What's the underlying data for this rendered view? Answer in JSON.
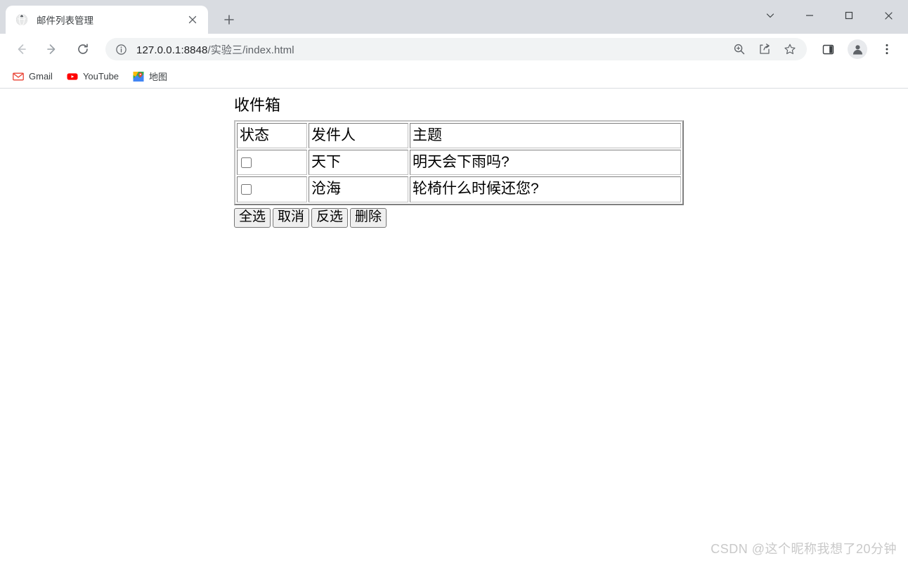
{
  "browser": {
    "tab": {
      "title": "邮件列表管理",
      "favicon": "globe-icon",
      "close_label": "×"
    },
    "new_tab_label": "+",
    "window_controls": {
      "tab_search": "tab-search-icon",
      "minimize": "minimize-icon",
      "maximize": "maximize-icon",
      "close": "close-icon"
    },
    "toolbar": {
      "back": "back-arrow-icon",
      "forward": "forward-arrow-icon",
      "reload": "reload-icon",
      "site_info": "info-circle-icon",
      "url_host": "127.0.0.1:8848",
      "url_path": "/实验三/index.html",
      "url_full": "127.0.0.1:8848/实验三/index.html",
      "zoom": "zoom-in-icon",
      "share": "share-icon",
      "bookmark": "star-icon",
      "side_panel": "side-panel-icon",
      "profile": "profile-avatar-icon",
      "menu": "three-dot-menu-icon"
    },
    "bookmarks": [
      {
        "label": "Gmail",
        "icon": "gmail-icon"
      },
      {
        "label": "YouTube",
        "icon": "youtube-icon"
      },
      {
        "label": "地图",
        "icon": "google-maps-icon"
      }
    ]
  },
  "page": {
    "heading": "收件箱",
    "table": {
      "headers": [
        "状态",
        "发件人",
        "主题"
      ],
      "rows": [
        {
          "checked": false,
          "sender": "天下",
          "subject": "明天会下雨吗?"
        },
        {
          "checked": false,
          "sender": "沧海",
          "subject": "轮椅什么时候还您?"
        }
      ]
    },
    "buttons": [
      {
        "label": "全选",
        "name": "select-all-button"
      },
      {
        "label": "取消",
        "name": "deselect-all-button"
      },
      {
        "label": "反选",
        "name": "invert-selection-button"
      },
      {
        "label": "删除",
        "name": "delete-button"
      }
    ]
  },
  "watermark": "CSDN @这个昵称我想了20分钟",
  "colors": {
    "tabstrip_bg": "#d9dce1",
    "toolbar_bg": "#ffffff",
    "omnibox_bg": "#f1f3f4",
    "text_primary": "#202124",
    "text_secondary": "#5f6368",
    "button_bg": "#efefef",
    "watermark": "#c9c9c9"
  }
}
